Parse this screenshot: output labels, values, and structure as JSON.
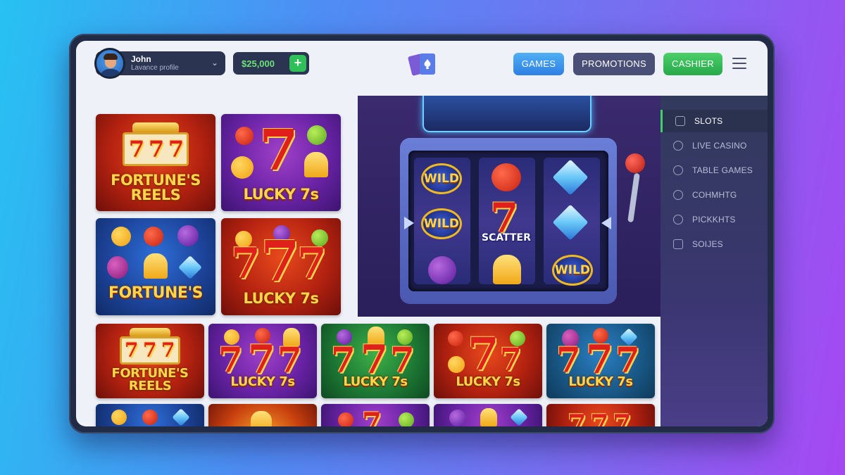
{
  "header": {
    "user_name": "John",
    "user_subtitle": "Lavance profile",
    "balance": "$25,000",
    "nav": {
      "games": "GAMES",
      "promotions": "PROMOTIONS",
      "cashier": "CASHIER"
    }
  },
  "tiles": {
    "t1": [
      "FORTUNE'S",
      "REELS"
    ],
    "t2": "LUCKY 7s",
    "t3": "FORTUNE'S",
    "t4": "LUCKY 7s",
    "t5": [
      "FORTUNE'S",
      "REELS"
    ],
    "t6": "LUCKY 7s",
    "t7": "LUCKY 7s",
    "t8": "LUCKY 7s",
    "t9": "LUCKY 7s"
  },
  "machine": {
    "wild": "WILD",
    "scatter": "SCATTER",
    "seven": "7"
  },
  "sidebar": {
    "items": [
      {
        "label": "SLOTS",
        "icon": "slots-icon",
        "active": true
      },
      {
        "label": "LIVE CASINO",
        "icon": "live-casino-icon",
        "active": false
      },
      {
        "label": "TABLE GAMES",
        "icon": "table-games-icon",
        "active": false
      },
      {
        "label": "COHMHTG",
        "icon": "coin-icon",
        "active": false
      },
      {
        "label": "PICKKHTS",
        "icon": "ball-icon",
        "active": false
      },
      {
        "label": "SOIJES",
        "icon": "grid-icon",
        "active": false
      }
    ]
  },
  "colors": {
    "accent_blue": "#2f7fe3",
    "accent_green": "#27a84a",
    "promotions_bg": "#4a4f78",
    "balance_text": "#6ee07a"
  }
}
